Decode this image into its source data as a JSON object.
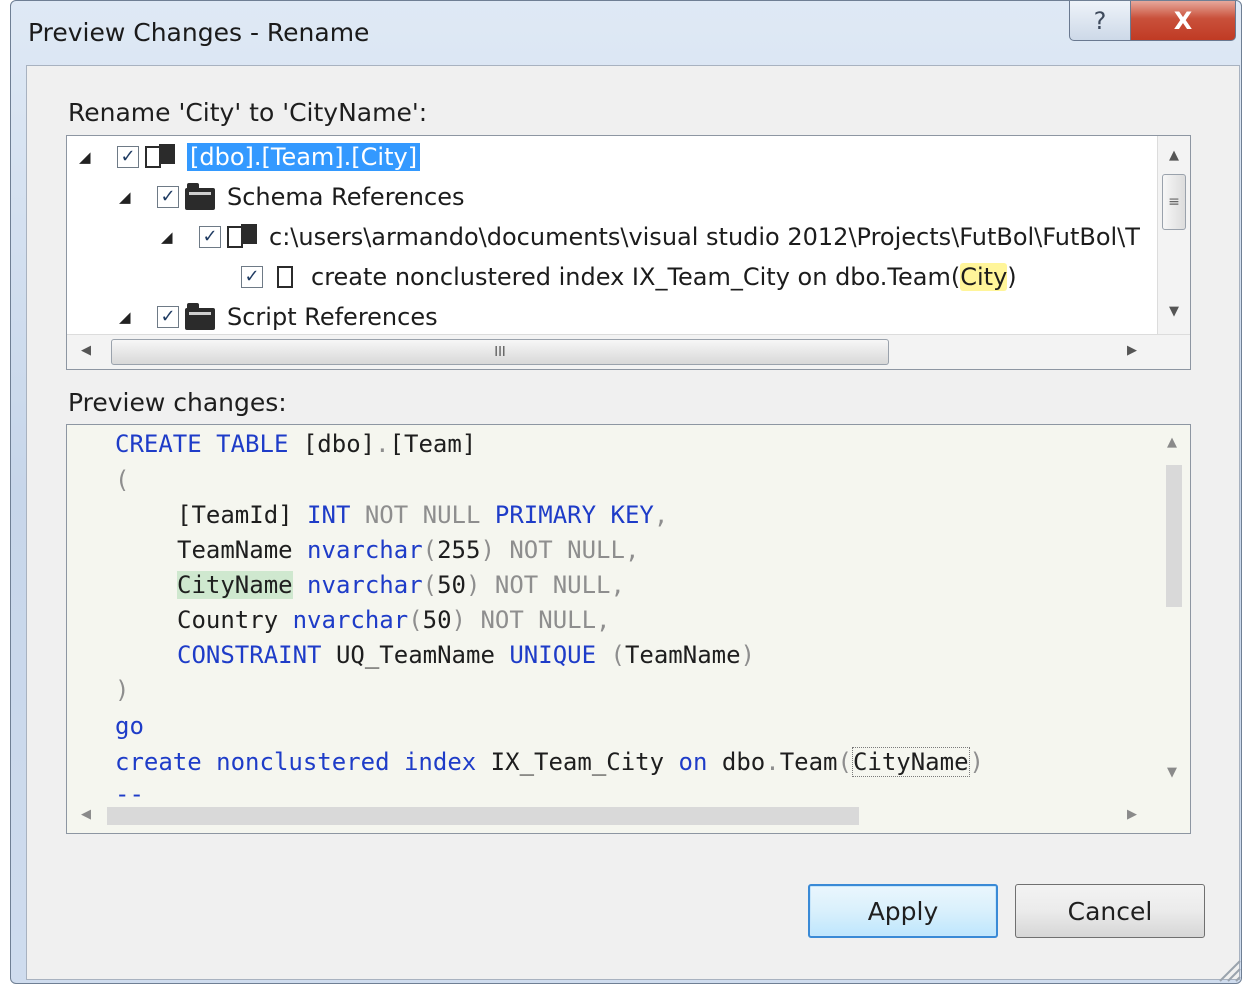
{
  "window": {
    "title": "Preview Changes - Rename",
    "help_glyph": "?",
    "close_glyph": "X"
  },
  "rename_label": "Rename 'City' to 'CityName':",
  "tree": {
    "rows": [
      {
        "label": "[dbo].[Team].[City]",
        "checked": true,
        "icon": "database-object-icon",
        "expander": "◢"
      },
      {
        "label": "Schema References",
        "checked": true,
        "icon": "folder-icon",
        "expander": "◢"
      },
      {
        "label": "c:\\users\\armando\\documents\\visual studio 2012\\Projects\\FutBol\\FutBol\\T",
        "checked": true,
        "icon": "file-icon",
        "expander": "◢"
      },
      {
        "label_before": "create nonclustered index IX_Team_City on dbo.Team(",
        "label_highlight": "City",
        "label_after": ")",
        "checked": true,
        "icon": "script-icon"
      },
      {
        "label": "Script References",
        "checked": true,
        "icon": "folder-icon",
        "expander": "◢"
      }
    ],
    "check_glyph": "✓",
    "scroll_up": "▲",
    "scroll_down": "▼",
    "scroll_left": "◀",
    "scroll_right": "▶",
    "vgrip": "≡",
    "hgrip": "III"
  },
  "preview_label": "Preview changes:",
  "code": {
    "l1_kw": "CREATE TABLE",
    "l1_rest": " [dbo]",
    "l1_dot": ".",
    "l1_end": "[Team]",
    "l2": "(",
    "l3_a": "[TeamId] ",
    "l3_kw": "INT",
    "l3_gr": " NOT NULL ",
    "l3_kw2": "PRIMARY KEY",
    "l3_end": ",",
    "l4_a": "TeamName ",
    "l4_kw": "nvarchar",
    "l4_p1": "(",
    "l4_n": "255",
    "l4_p2": ")",
    "l4_gr": " NOT NULL,",
    "l5_add": "CityName",
    "l5_sp": " ",
    "l5_kw": "nvarchar",
    "l5_p1": "(",
    "l5_n": "50",
    "l5_p2": ")",
    "l5_gr": " NOT NULL,",
    "l6_a": "Country ",
    "l6_kw": "nvarchar",
    "l6_p1": "(",
    "l6_n": "50",
    "l6_p2": ")",
    "l6_gr": " NOT NULL,",
    "l7_kw": "CONSTRAINT",
    "l7_a": " UQ_TeamName ",
    "l7_kw2": "UNIQUE",
    "l7_p1": " (",
    "l7_b": "TeamName",
    "l7_p2": ")",
    "l8": ")",
    "l9": "go",
    "l10_kw": "create nonclustered index",
    "l10_a": " IX_Team_City ",
    "l10_kw2": "on",
    "l10_b": " dbo",
    "l10_dot": ".",
    "l10_c": "Team",
    "l10_p1": "(",
    "l10_box": "CityName",
    "l10_p2": ")",
    "l11": "--"
  },
  "buttons": {
    "apply": "Apply",
    "cancel": "Cancel"
  }
}
